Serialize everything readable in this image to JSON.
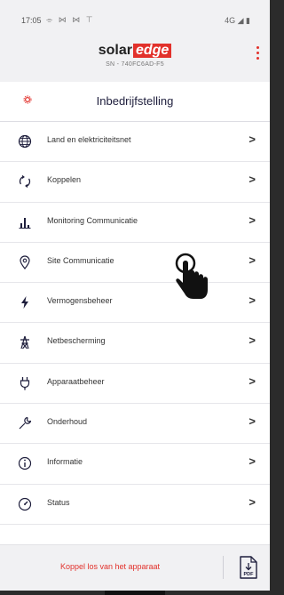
{
  "status_bar": {
    "time": "17:05",
    "notifications": "⌯ ⋈ ⋈ ⊤",
    "network": "4G ◢ ▮"
  },
  "header": {
    "logo_word": "solar",
    "logo_accent": "edge",
    "serial": "SN - 740FC6AD-F5",
    "menu_icon": "more-vertical-icon",
    "brand_color": "#e2312b"
  },
  "page": {
    "title": "Inbedrijfstelling",
    "title_icon": "gear-icon"
  },
  "menu": {
    "items": [
      {
        "label": "Land en elektriciteitsnet",
        "icon": "globe-icon"
      },
      {
        "label": "Koppelen",
        "icon": "sync-icon"
      },
      {
        "label": "Monitoring Communicatie",
        "icon": "bar-chart-icon"
      },
      {
        "label": "Site Communicatie",
        "icon": "location-pin-icon"
      },
      {
        "label": "Vermogensbeheer",
        "icon": "lightning-icon"
      },
      {
        "label": "Netbescherming",
        "icon": "power-tower-icon"
      },
      {
        "label": "Apparaatbeheer",
        "icon": "plug-icon"
      },
      {
        "label": "Onderhoud",
        "icon": "wrench-icon"
      },
      {
        "label": "Informatie",
        "icon": "info-icon"
      },
      {
        "label": "Status",
        "icon": "gauge-icon"
      }
    ],
    "chevron": ">"
  },
  "footer": {
    "disconnect_label": "Koppel los van het apparaat",
    "pdf_icon": "pdf-download-icon",
    "pdf_label": "PDF"
  }
}
